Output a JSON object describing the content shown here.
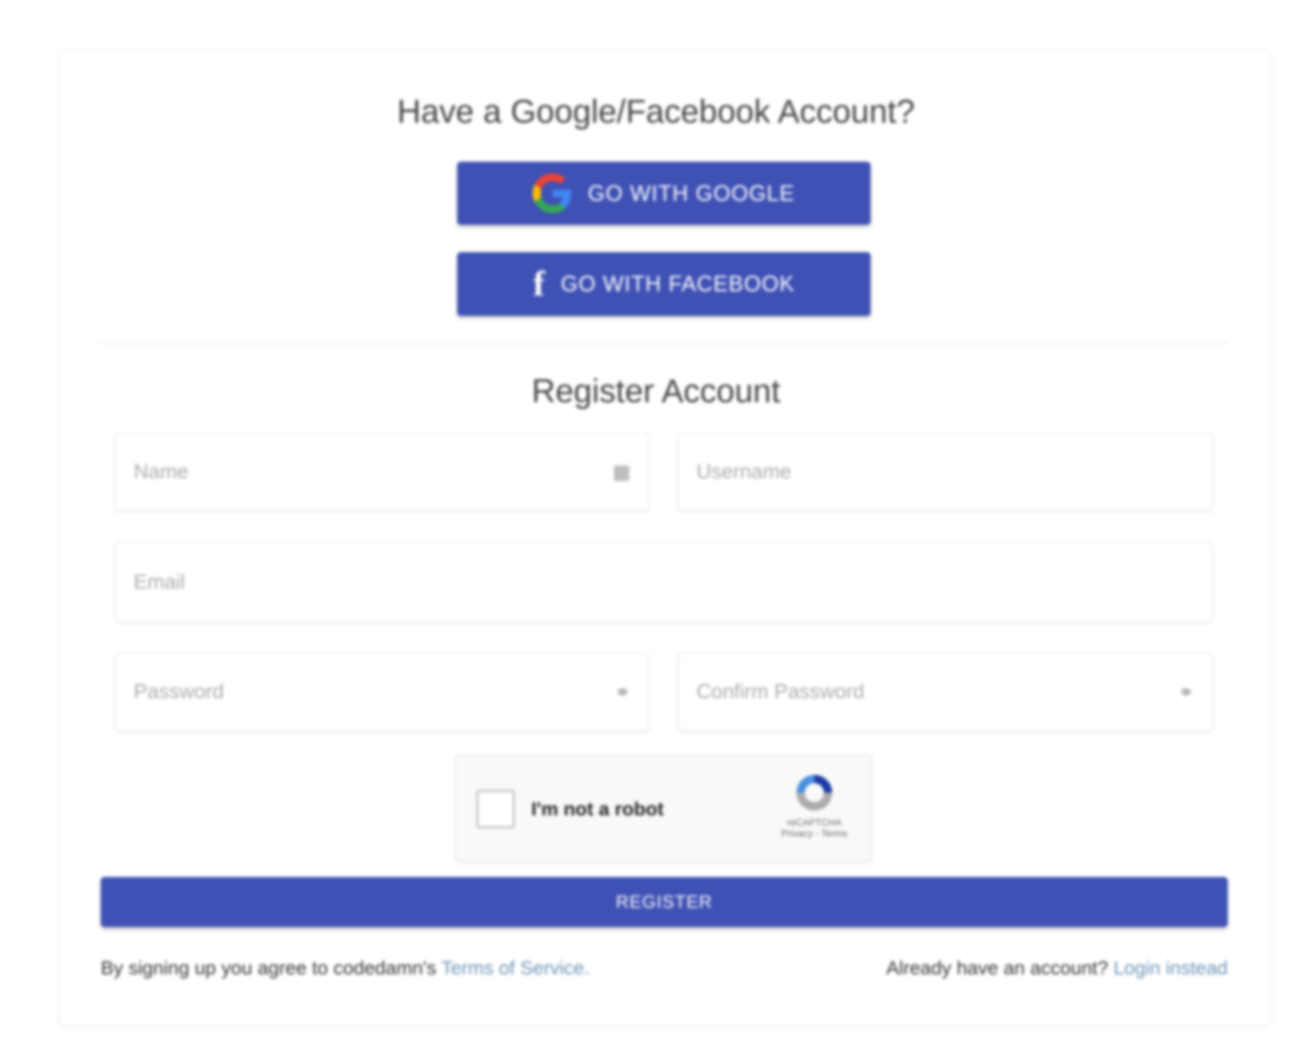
{
  "social": {
    "title": "Have a Google/Facebook Account?",
    "google_label": "GO WITH GOOGLE",
    "facebook_label": "GO WITH FACEBOOK"
  },
  "register": {
    "title": "Register Account",
    "name_placeholder": "Name",
    "username_placeholder": "Username",
    "email_placeholder": "Email",
    "password_placeholder": "Password",
    "confirm_placeholder": "Confirm Password",
    "button_label": "REGISTER"
  },
  "captcha": {
    "label": "I'm not a robot",
    "brand": "reCAPTCHA",
    "privacy": "Privacy",
    "terms": "Terms"
  },
  "footer": {
    "agree_text": "By signing up you agree to codedamn's ",
    "terms_link": "Terms of Service.",
    "already_text": "Already have an account? ",
    "login_link": "Login instead"
  },
  "colors": {
    "primary": "#3f51b5",
    "link": "#6b93b8"
  }
}
